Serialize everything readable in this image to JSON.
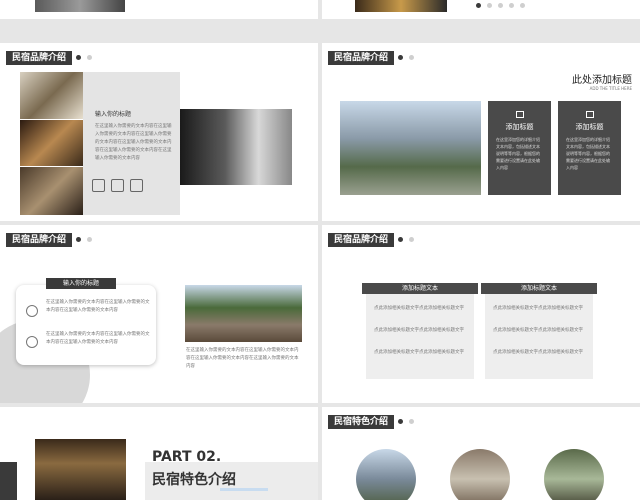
{
  "slide3": {
    "tag": "民宿品牌介绍",
    "heading": "输入你的标题",
    "body": "在这里输入你需要的文本内容在这里输入你需要的文本内容在这里输入你需要的文本内容在这里输入你需要的文本内容在这里输入你需要的文本内容在这里输入你需要的文本内容"
  },
  "slide4": {
    "tag": "民宿品牌介绍",
    "title": "此处添加标题",
    "subtitle": "ADD THE TITLE HERE",
    "cards": [
      {
        "title": "添加标题",
        "body": "在这里添加您的详细介绍文本内容，包括描述文本说明等等内容，根据您的需要进行设置请在此处输入内容"
      },
      {
        "title": "添加标题",
        "body": "在这里添加您的详细介绍文本内容，包括描述文本说明等等内容，根据您的需要进行设置请在此处输入内容"
      }
    ]
  },
  "slide5": {
    "tag": "民宿品牌介绍",
    "banner": "输入你的标题",
    "items": [
      "在这里输入你需要的文本内容在这里输入你需要的文本内容在这里输入你需要的文本内容",
      "在这里输入你需要的文本内容在这里输入你需要的文本内容在这里输入你需要的文本内容"
    ],
    "caption": "在这里输入你需要的文本内容在这里输入你需要的文本内容在这里输入你需要的文本内容在这里输入你需要的文本内容"
  },
  "slide6": {
    "tag": "民宿品牌介绍",
    "panels": [
      {
        "label": "添加标题文本",
        "lines": [
          "点此添加相关标题文字点此添加相关标题文字",
          "点此添加相关标题文字点此添加相关标题文字",
          "点此添加相关标题文字点此添加相关标题文字"
        ]
      },
      {
        "label": "添加标题文本",
        "lines": [
          "点此添加相关标题文字点此添加相关标题文字",
          "点此添加相关标题文字点此添加相关标题文字",
          "点此添加相关标题文字点此添加相关标题文字"
        ]
      }
    ]
  },
  "slide7": {
    "part": "PART 02.",
    "title": "民宿特色介绍"
  },
  "slide8": {
    "tag": "民宿特色介绍"
  }
}
